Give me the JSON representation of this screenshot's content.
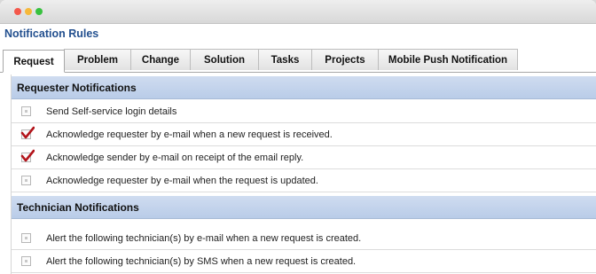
{
  "header": {
    "title": "Notification Rules"
  },
  "tabs": [
    {
      "label": "Request",
      "active": true
    },
    {
      "label": "Problem",
      "active": false
    },
    {
      "label": "Change",
      "active": false
    },
    {
      "label": "Solution",
      "active": false
    },
    {
      "label": "Tasks",
      "active": false
    },
    {
      "label": "Projects",
      "active": false
    },
    {
      "label": "Mobile Push Notification",
      "active": false
    }
  ],
  "sections": [
    {
      "title": "Requester Notifications",
      "items": [
        {
          "label": "Send Self-service login details",
          "checked": false
        },
        {
          "label": "Acknowledge requester by e-mail when a new request is received.",
          "checked": true
        },
        {
          "label": "Acknowledge sender by e-mail on receipt of the email reply.",
          "checked": true
        },
        {
          "label": "Acknowledge requester by e-mail when the request is updated.",
          "checked": false
        }
      ]
    },
    {
      "title": "Technician Notifications",
      "items": [
        {
          "label": "Alert the following technician(s) by e-mail when a new request is created.",
          "checked": false
        },
        {
          "label": "Alert the following technician(s) by SMS when a new request is created.",
          "checked": false
        }
      ]
    }
  ],
  "colors": {
    "accent_title": "#23508f",
    "section_header": "#c4d5ee",
    "check": "#b3141b"
  }
}
